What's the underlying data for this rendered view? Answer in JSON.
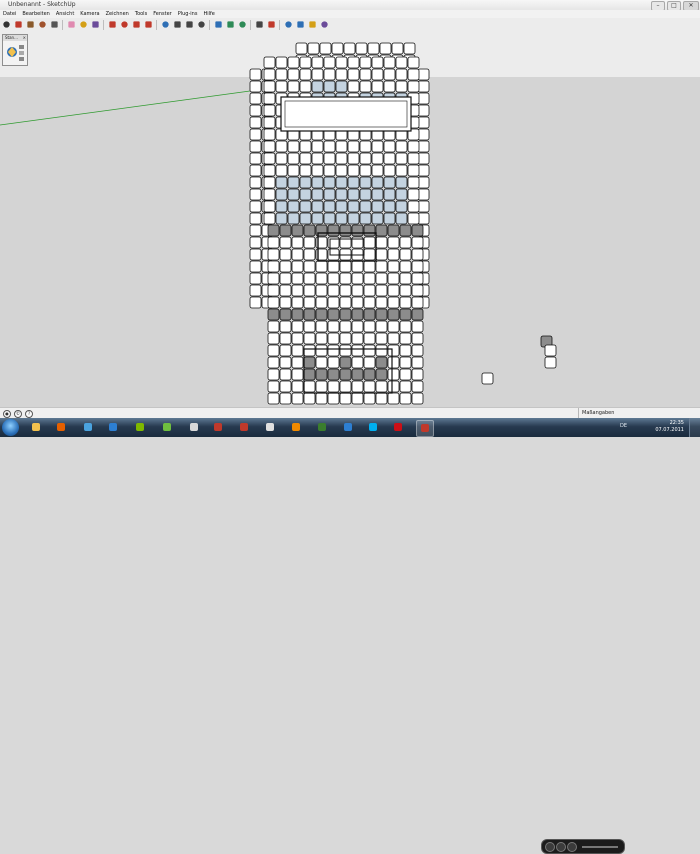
{
  "window": {
    "title": "Unbenannt - SketchUp",
    "controls": [
      "–",
      "□",
      "✕"
    ]
  },
  "menu": [
    "Datei",
    "Bearbeiten",
    "Ansicht",
    "Kamera",
    "Zeichnen",
    "Tools",
    "Fenster",
    "Plug-ins",
    "Hilfe"
  ],
  "toolbar": {
    "tools": [
      {
        "icon": "select-arrow-icon",
        "color": "#333333"
      },
      {
        "icon": "line-pencil-icon",
        "color": "#c0392b"
      },
      {
        "icon": "rectangle-icon",
        "color": "#8a5a2b"
      },
      {
        "icon": "circle-icon",
        "color": "#a0522d"
      },
      {
        "icon": "arc-icon",
        "color": "#555555"
      },
      {
        "icon": "eraser-icon",
        "color": "#e08ab0"
      },
      {
        "icon": "tape-measure-icon",
        "color": "#d4a017"
      },
      {
        "icon": "paint-bucket-icon",
        "color": "#6b4c9a"
      },
      {
        "icon": "push-pull-icon",
        "color": "#c0392b"
      },
      {
        "icon": "move-icon",
        "color": "#c0392b"
      },
      {
        "icon": "rotate-icon",
        "color": "#c0392b"
      },
      {
        "icon": "offset-icon",
        "color": "#c0392b"
      },
      {
        "icon": "orbit-icon",
        "color": "#2e6fb5"
      },
      {
        "icon": "pan-icon",
        "color": "#444444"
      },
      {
        "icon": "zoom-icon",
        "color": "#444444"
      },
      {
        "icon": "zoom-window-icon",
        "color": "#444444"
      },
      {
        "icon": "zoom-extents-icon",
        "color": "#2e6fb5"
      },
      {
        "icon": "previous-view-icon",
        "color": "#2e8b57"
      },
      {
        "icon": "next-view-icon",
        "color": "#2e8b57"
      },
      {
        "icon": "model-info-icon",
        "color": "#444444"
      },
      {
        "icon": "get-models-icon",
        "color": "#c0392b"
      },
      {
        "icon": "share-model-icon",
        "color": "#2e6fb5"
      },
      {
        "icon": "share-component-icon",
        "color": "#2e6fb5"
      },
      {
        "icon": "get-photo-texture-icon",
        "color": "#d4a017"
      },
      {
        "icon": "add-location-icon",
        "color": "#6b4c9a"
      }
    ]
  },
  "tray": {
    "title": "Stan...",
    "close": "×"
  },
  "model": {
    "cell_color": "#ffffff",
    "edge_color": "#111111",
    "tinted_color": "#c4d3e0",
    "shadow_color": "#8c8c8c",
    "axis_green": "#2e9a2e",
    "panel_fill": "#ffffff"
  },
  "statusbar": {
    "measurements_label": "Maßangaben"
  },
  "taskbar": {
    "apps": [
      {
        "icon": "explorer-folder-icon",
        "color": "#f2c14e"
      },
      {
        "icon": "firefox-icon",
        "color": "#e66000"
      },
      {
        "icon": "itunes-icon",
        "color": "#4aa3df"
      },
      {
        "icon": "media-player-icon",
        "color": "#2d7fd2"
      },
      {
        "icon": "nero-icon",
        "color": "#7fb800"
      },
      {
        "icon": "sims-icon",
        "color": "#6fbf3f"
      },
      {
        "icon": "paint-icon",
        "color": "#d9d9d9"
      },
      {
        "icon": "sketch-app-icon",
        "color": "#c0392b"
      },
      {
        "icon": "filezilla-icon",
        "color": "#c0392b"
      },
      {
        "icon": "notepad-icon",
        "color": "#e0e0e0"
      },
      {
        "icon": "vlc-icon",
        "color": "#f08a00"
      },
      {
        "icon": "game-icon",
        "color": "#3a7d2d"
      },
      {
        "icon": "browser-icon",
        "color": "#2d7fd2"
      },
      {
        "icon": "skype-icon",
        "color": "#00aff0"
      },
      {
        "icon": "opera-icon",
        "color": "#cc0f16"
      },
      {
        "icon": "sketchup-icon",
        "color": "#c0392b"
      }
    ],
    "language": "DE",
    "time": "22:35",
    "date": "07.07.2011"
  }
}
